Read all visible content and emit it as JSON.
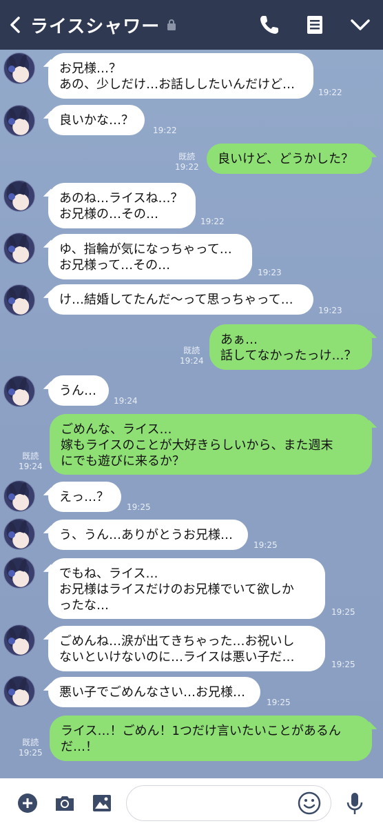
{
  "header": {
    "title": "ライスシャワー",
    "back_icon": "chevron-left-icon",
    "lock_icon": "lock-icon"
  },
  "header_actions": [
    {
      "name": "call-button",
      "icon": "phone-icon"
    },
    {
      "name": "notes-button",
      "icon": "note-icon"
    },
    {
      "name": "menu-button",
      "icon": "chevron-down-icon"
    }
  ],
  "messages": [
    {
      "side": "in",
      "text": "お兄様…？\nあの、少しだけ…お話ししたいんだけど…",
      "time": "19:22"
    },
    {
      "side": "in",
      "text": "良いかな…？",
      "time": "19:22"
    },
    {
      "side": "out",
      "text": "良いけど、どうかした？",
      "read": "既読",
      "time": "19:22"
    },
    {
      "side": "in",
      "text": "あのね…ライスね…？\nお兄様の…その…",
      "time": "19:22"
    },
    {
      "side": "in",
      "text": "ゆ、指輪が気になっちゃって…\nお兄様って…その…",
      "time": "19:23"
    },
    {
      "side": "in",
      "text": "け…結婚してたんだ〜って思っちゃって…",
      "time": "19:23"
    },
    {
      "side": "out",
      "text": "あぁ…\n話してなかったっけ…？",
      "read": "既読",
      "time": "19:24"
    },
    {
      "side": "in",
      "text": "うん…",
      "time": "19:24"
    },
    {
      "side": "out",
      "text": "ごめんな、ライス…\n嫁もライスのことが大好きらしいから、また週末\nにでも遊びに来るか？",
      "read": "既読",
      "time": "19:24"
    },
    {
      "side": "in",
      "text": "えっ…？",
      "time": "19:25"
    },
    {
      "side": "in",
      "text": "う、うん…ありがとうお兄様…",
      "time": "19:25"
    },
    {
      "side": "in",
      "text": "でもね、ライス…\nお兄様はライスだけのお兄様でいて欲しか\nったな…",
      "time": "19:25"
    },
    {
      "side": "in",
      "text": "ごめんね…涙が出てきちゃった…お祝いし\nないといけないのに…ライスは悪い子だ…",
      "time": "19:25"
    },
    {
      "side": "in",
      "text": "悪い子でごめんなさい…お兄様…",
      "time": "19:25"
    },
    {
      "side": "out",
      "text": "ライス…！ごめん！1つだけ言いたいことがあるん\nだ…！",
      "read": "既読",
      "time": "19:25"
    }
  ],
  "footer": {
    "icons": [
      "plus-icon",
      "camera-icon",
      "image-icon",
      "emoji-icon",
      "mic-icon"
    ],
    "input_placeholder": ""
  },
  "colors": {
    "header_bg": "#2f3a52",
    "chat_bg": "#8da3c6",
    "incoming_bubble": "#ffffff",
    "outgoing_bubble": "#8fe074"
  }
}
